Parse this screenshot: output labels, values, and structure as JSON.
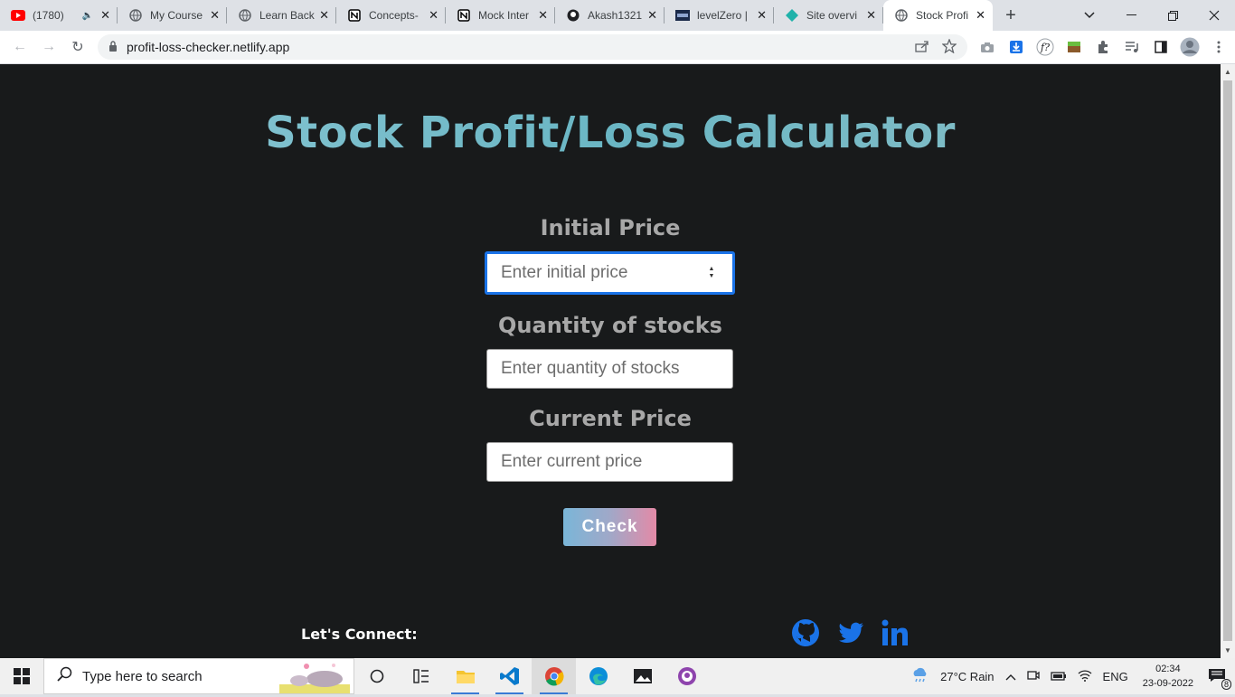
{
  "browser": {
    "tabs": [
      {
        "title": "(1780)",
        "audio": true
      },
      {
        "title": "My Course"
      },
      {
        "title": "Learn Back"
      },
      {
        "title": "Concepts-"
      },
      {
        "title": "Mock Inter"
      },
      {
        "title": "Akash1321"
      },
      {
        "title": "levelZero |"
      },
      {
        "title": "Site overvi"
      },
      {
        "title": "Stock Profi",
        "active": true
      }
    ],
    "url": "profit-loss-checker.netlify.app"
  },
  "page": {
    "title": "Stock Profit/Loss Calculator",
    "initial_price": {
      "label": "Initial Price",
      "placeholder": "Enter initial price"
    },
    "quantity": {
      "label": "Quantity of stocks",
      "placeholder": "Enter quantity of stocks"
    },
    "current_price": {
      "label": "Current Price",
      "placeholder": "Enter current price"
    },
    "check_label": "Check",
    "footer": {
      "connect_label": "Let's Connect:"
    }
  },
  "taskbar": {
    "search_placeholder": "Type here to search",
    "weather": "27°C  Rain",
    "language": "ENG",
    "time": "02:34",
    "date": "23-09-2022",
    "notification_count": "8"
  }
}
